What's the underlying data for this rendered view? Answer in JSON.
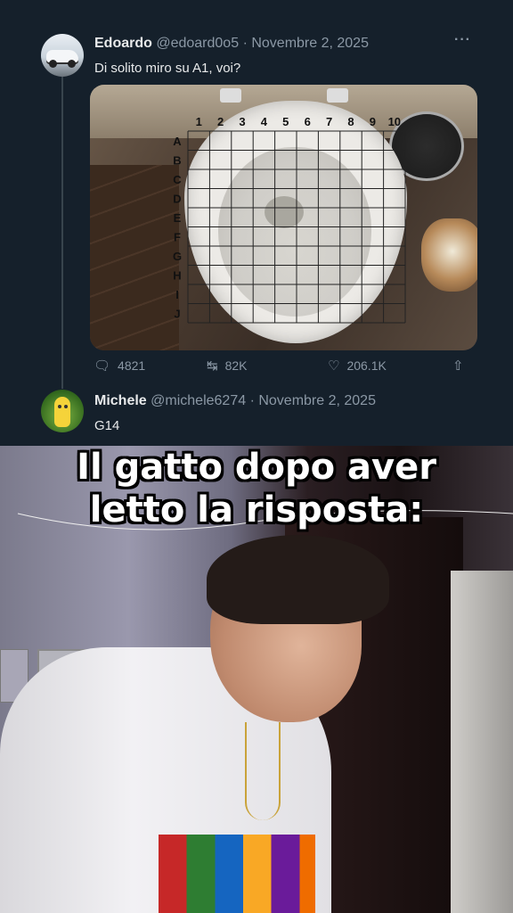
{
  "tweet1": {
    "name": "Edoardo",
    "handle": "@edoard0o5",
    "separator": "·",
    "date": "Novembre 2, 2025",
    "text": "Di solito miro su A1, voi?",
    "more": "···",
    "grid": {
      "columns": [
        "1",
        "2",
        "3",
        "4",
        "5",
        "6",
        "7",
        "8",
        "9",
        "10"
      ],
      "rows": [
        "A",
        "B",
        "C",
        "D",
        "E",
        "F",
        "G",
        "H",
        "I",
        "J"
      ]
    },
    "stats": {
      "replies": "4821",
      "retweets": "82K",
      "likes": "206.1K"
    }
  },
  "tweet2": {
    "name": "Michele",
    "handle": "@michele6274",
    "separator": "·",
    "date": "Novembre 2, 2025",
    "text": "G14",
    "more": "···"
  },
  "caption": {
    "line1": "Il gatto dopo aver",
    "line2": "letto la risposta:"
  },
  "icons": {
    "reply": "reply-icon",
    "retweet": "retweet-icon",
    "like": "heart-icon",
    "share": "share-icon"
  }
}
